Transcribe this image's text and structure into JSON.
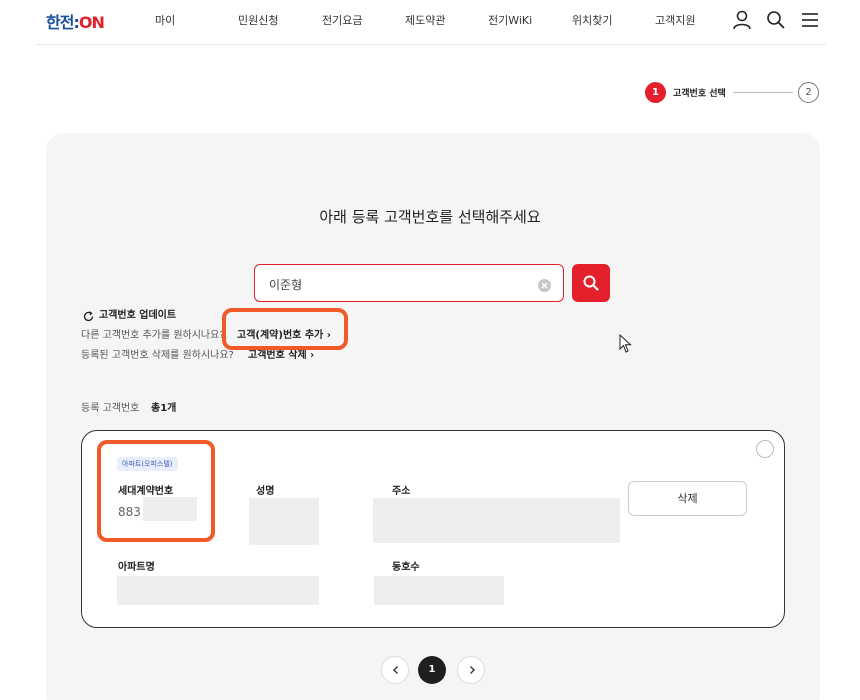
{
  "header": {
    "logo_main": "한전:",
    "logo_accent": "ON",
    "nav": [
      "마이",
      "민원신청",
      "전기요금",
      "제도약관",
      "전기WiKi",
      "위치찾기",
      "고객지원"
    ],
    "icons": [
      "user-icon",
      "search-icon",
      "menu-icon"
    ]
  },
  "stepper": {
    "current_number": "1",
    "current_label": "고객번호 선택",
    "next_number": "2"
  },
  "main": {
    "title": "아래 등록 고객번호를 선택해주세요",
    "search": {
      "value": "이준형"
    },
    "update_label": "고객번호 업데이트",
    "add_prompt": "다른 고객번호 추가를 원하시나요?",
    "add_link": "고객(계약)번호 추가",
    "delete_prompt": "등록된 고객번호 삭제를 원하시나요?",
    "delete_link": "고객번호 삭제",
    "count_label": "등록 고객번호",
    "count_value": "총1개"
  },
  "card": {
    "badge": "아파트(오피스텔)",
    "household_label": "세대계약번호",
    "household_value": "883",
    "name_label": "성명",
    "address_label": "주소",
    "apt_label": "아파트명",
    "unit_label": "동호수",
    "delete_button": "삭제"
  },
  "pagination": {
    "current": "1"
  },
  "colors": {
    "accent": "#e4202c",
    "highlight": "#f05a28",
    "brand_blue": "#1a4fa0"
  }
}
